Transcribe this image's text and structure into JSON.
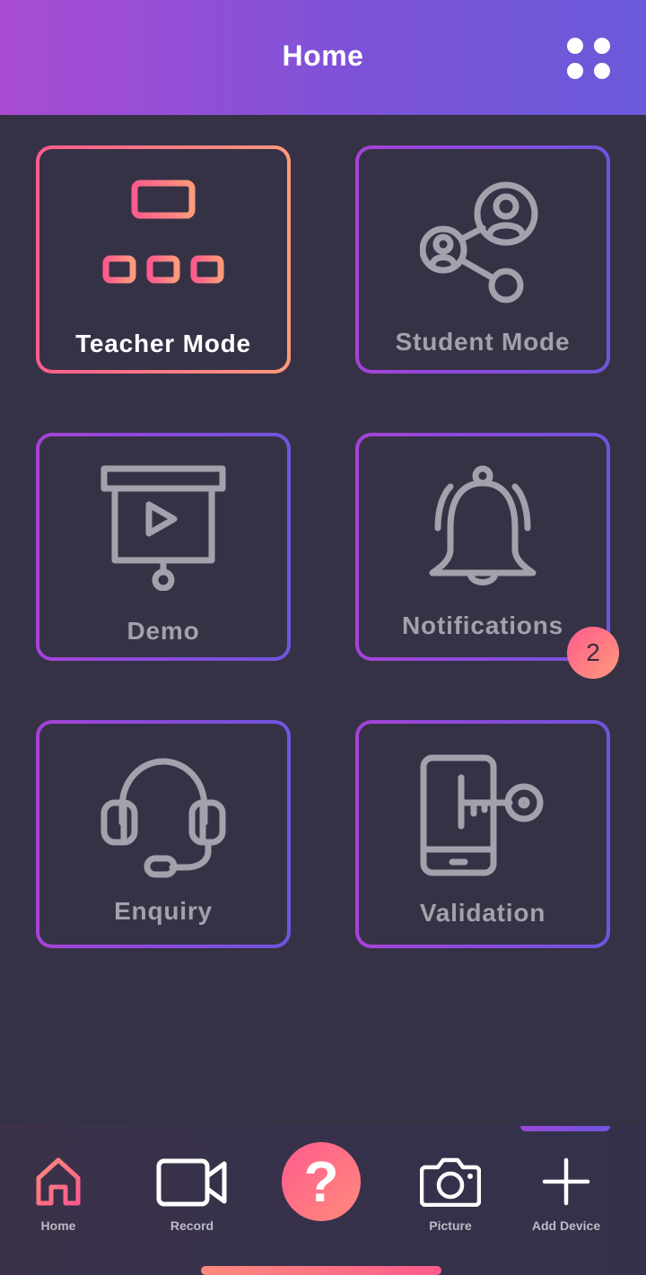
{
  "header": {
    "title": "Home",
    "menu_icon": "grid-dots-icon"
  },
  "tiles": [
    {
      "label": "Teacher Mode",
      "icon": "network-hierarchy-icon",
      "active": true
    },
    {
      "label": "Student Mode",
      "icon": "users-share-icon",
      "active": false
    },
    {
      "label": "Demo",
      "icon": "presentation-play-icon",
      "active": false
    },
    {
      "label": "Notifications",
      "icon": "bell-icon",
      "active": false,
      "badge": "2"
    },
    {
      "label": "Enquiry",
      "icon": "headset-icon",
      "active": false
    },
    {
      "label": "Validation",
      "icon": "phone-key-icon",
      "active": false
    }
  ],
  "tabbar": {
    "items": [
      {
        "label": "Home",
        "icon": "home-icon"
      },
      {
        "label": "Record",
        "icon": "video-camera-icon"
      },
      {
        "label": "?",
        "icon": "help-icon"
      },
      {
        "label": "Picture",
        "icon": "camera-icon"
      },
      {
        "label": "Add Device",
        "icon": "plus-icon"
      }
    ]
  },
  "colors": {
    "accent_gradient_start": "#ff5b8d",
    "accent_gradient_end": "#ff9a7b",
    "purple_gradient_start": "#a542d9",
    "purple_gradient_end": "#6f55df",
    "background": "#363246",
    "icon_gray": "#a3a1ab"
  }
}
